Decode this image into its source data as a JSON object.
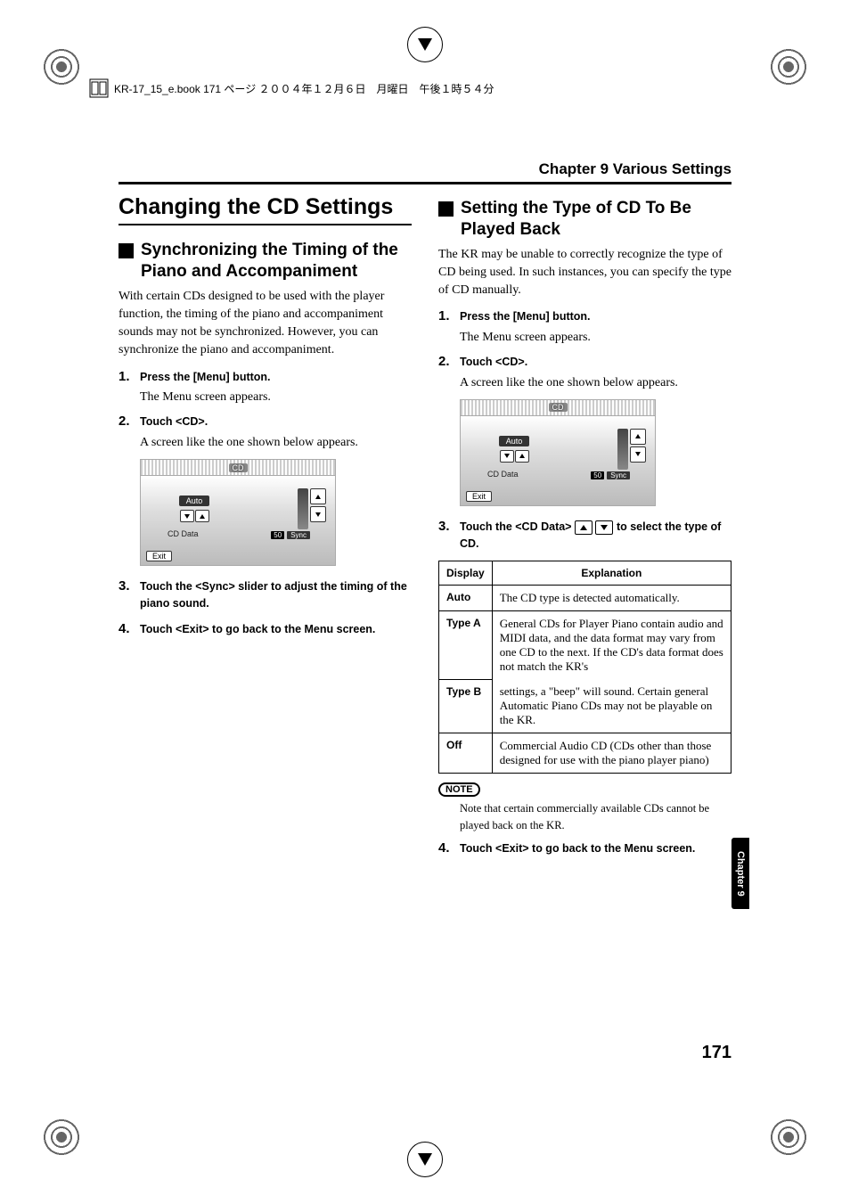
{
  "print_header": "KR-17_15_e.book  171 ページ  ２００４年１２月６日　月曜日　午後１時５４分",
  "chapter_title": "Chapter 9 Various Settings",
  "h1": "Changing the CD Settings",
  "left": {
    "h2": "Synchronizing the Timing of the Piano and Accompaniment",
    "intro": "With certain CDs designed to be used with the player function, the timing of the piano and accompaniment sounds may not be synchronized. However, you can synchronize the piano and accompaniment.",
    "steps": [
      {
        "n": "1.",
        "t": "Press the [Menu] button.",
        "sub": "The Menu screen appears."
      },
      {
        "n": "2.",
        "t": "Touch <CD>.",
        "sub": "A screen like the one shown below appears."
      },
      {
        "n": "3.",
        "t": "Touch the <Sync> slider to adjust the timing of the piano sound."
      },
      {
        "n": "4.",
        "t": "Touch <Exit> to go back to the Menu screen."
      }
    ]
  },
  "right": {
    "h2": "Setting the Type of CD To Be Played Back",
    "intro": "The KR may be unable to correctly recognize the type of CD being used. In such instances, you can specify the type of CD manually.",
    "steps_a": [
      {
        "n": "1.",
        "t": "Press the [Menu] button.",
        "sub": "The Menu screen appears."
      },
      {
        "n": "2.",
        "t": "Touch <CD>.",
        "sub": "A screen like the one shown below appears."
      }
    ],
    "step3_pre": "Touch the <CD Data> ",
    "step3_post": " to select the type of CD.",
    "step3_n": "3.",
    "table": {
      "head": [
        "Display",
        "Explanation"
      ],
      "rows": [
        {
          "k": "Auto",
          "v": "The CD type is detected automatically."
        },
        {
          "k": "Type A",
          "v": "General CDs for Player Piano contain audio and MIDI data, and the data format may vary from one CD to the next. If the CD's data format does not match the KR's"
        },
        {
          "k": "Type B",
          "v": "settings, a \"beep\" will sound. Certain general Automatic Piano CDs may not be playable on the KR."
        },
        {
          "k": "Off",
          "v": "Commercial Audio CD (CDs other than those designed for use with the piano player piano)"
        }
      ]
    },
    "note_label": "NOTE",
    "note": "Note that certain commercially available CDs cannot be played back on the KR.",
    "step4": {
      "n": "4.",
      "t": "Touch <Exit> to go back to the Menu screen."
    }
  },
  "screen": {
    "title": "CD",
    "auto": "Auto",
    "cddata": "CD Data",
    "sync_val": "50",
    "sync_lbl": "Sync",
    "exit": "Exit"
  },
  "side_tab": "Chapter 9",
  "page_number": "171"
}
